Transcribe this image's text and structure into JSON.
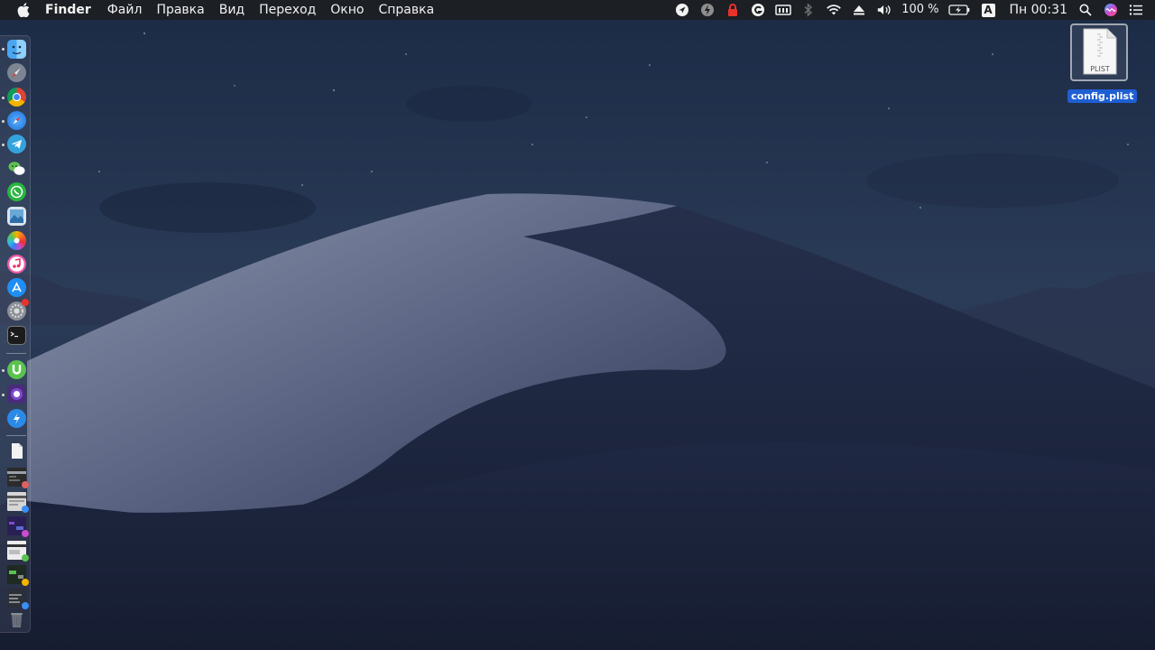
{
  "menubar": {
    "apple_icon": "apple-logo-icon",
    "app_name": "Finder",
    "menus": [
      "Файл",
      "Правка",
      "Вид",
      "Переход",
      "Окно",
      "Справка"
    ],
    "status": {
      "battery_percent": "100 %",
      "input_source": "A",
      "clock": "Пн 00:31"
    }
  },
  "desktop": {
    "file_icon": {
      "type_label": "PLIST",
      "name": "config.plist"
    }
  },
  "dock": {
    "apps": [
      "Finder",
      "Launchpad",
      "Google Chrome",
      "Safari",
      "Telegram",
      "WeChat",
      "WhatsApp",
      "Preview",
      "Photos",
      "iTunes",
      "App Store",
      "System Preferences",
      "Terminal",
      "uTorrent",
      "Tor Browser",
      "Scapple"
    ],
    "colors": {
      "selection": "#1f5fd4",
      "menubar": "#1c1e22"
    }
  }
}
